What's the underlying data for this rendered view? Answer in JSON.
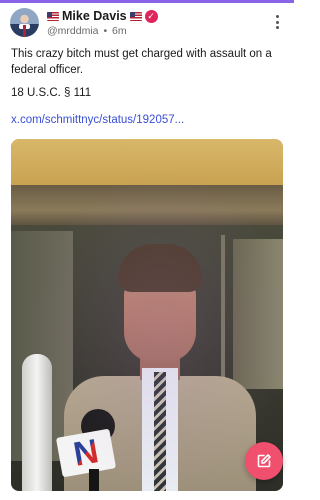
{
  "post": {
    "author": {
      "flag_left": "🇺🇸",
      "name": "Mike Davis",
      "flag_right": "🇺🇸",
      "verified_icon": "verified-badge-icon",
      "handle": "@mrddmia",
      "separator": "•",
      "time": "6m"
    },
    "text": "This crazy bitch must get charged with assault on a federal officer.",
    "citation": "18 U.S.C. § 111",
    "link": "x.com/schmittnyc/status/192057...",
    "media": {
      "type": "photo",
      "mic_flag_letter": "N"
    },
    "more_icon": "more-vertical-icon"
  },
  "fab": {
    "icon": "compose-icon",
    "color": "#f0506e"
  },
  "colors": {
    "accent": "#8a63e8",
    "link": "#3a4fd6",
    "verified": "#e0245e"
  }
}
